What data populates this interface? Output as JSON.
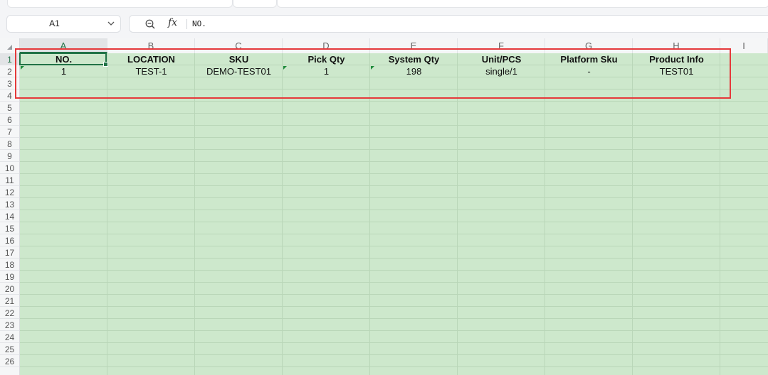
{
  "name_box": {
    "value": "A1"
  },
  "formula_bar": {
    "fx_label": "fx",
    "content": "NO."
  },
  "columns": [
    "A",
    "B",
    "C",
    "D",
    "E",
    "F",
    "G",
    "H",
    "I"
  ],
  "rows": [
    "1",
    "2",
    "3",
    "4",
    "5",
    "6",
    "7",
    "8",
    "9",
    "10",
    "11",
    "12",
    "13",
    "14",
    "15",
    "16",
    "17",
    "18",
    "19",
    "20",
    "21",
    "22",
    "23",
    "24",
    "25",
    "26"
  ],
  "sheet": {
    "header": [
      "NO.",
      "LOCATION",
      "SKU",
      "Pick Qty",
      "System Qty",
      "Unit/PCS",
      "Platform Sku",
      "Product Info"
    ],
    "row2": [
      "1",
      "TEST-1",
      "DEMO-TEST01",
      "1",
      "198",
      "single/1",
      "-",
      "TEST01"
    ]
  },
  "colors": {
    "cell_fill": "#cde8cc",
    "selection": "#217346",
    "highlight_box": "#e5393b"
  },
  "icons": {
    "zoom": "zoom-out-icon",
    "namebox_dropdown": "chevron-down-icon"
  }
}
